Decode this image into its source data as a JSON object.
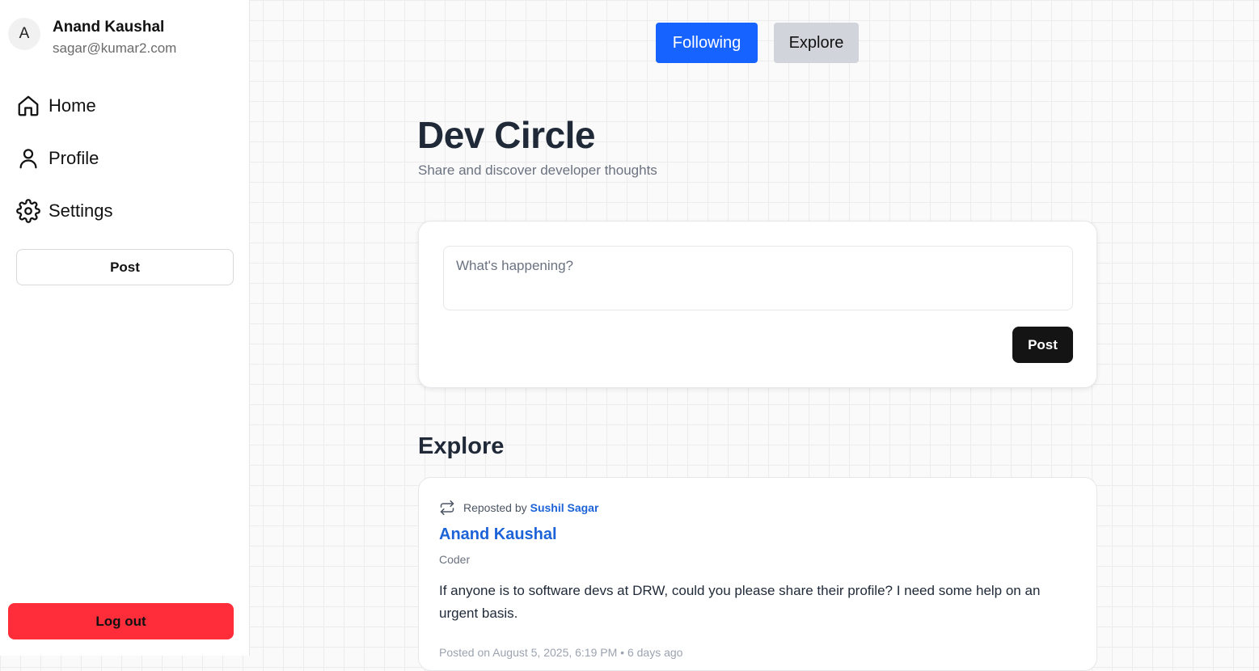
{
  "sidebar": {
    "user": {
      "avatar_initial": "A",
      "name": "Anand Kaushal",
      "email": "sagar@kumar2.com"
    },
    "nav": [
      {
        "label": "Home",
        "icon": "home-icon"
      },
      {
        "label": "Profile",
        "icon": "user-icon"
      },
      {
        "label": "Settings",
        "icon": "gear-icon"
      }
    ],
    "post_label": "Post",
    "logout_label": "Log out"
  },
  "tabs": {
    "following": "Following",
    "explore": "Explore",
    "active": "following"
  },
  "header": {
    "title": "Dev Circle",
    "subtitle": "Share and discover developer thoughts"
  },
  "composer": {
    "placeholder": "What's happening?",
    "post_label": "Post"
  },
  "feed": {
    "section_title": "Explore",
    "posts": [
      {
        "repost_prefix": "Reposted by",
        "reposted_by": "Sushil Sagar",
        "author": "Anand Kaushal",
        "role": "Coder",
        "body": "If anyone is to software devs at DRW, could you please share their profile? I need some help on an urgent basis.",
        "meta": "Posted on August 5, 2025, 6:19 PM • 6 days ago"
      }
    ]
  },
  "colors": {
    "accent": "#1763ff",
    "link": "#1d63d8",
    "danger": "#ff2d3a",
    "dark_button": "#141414",
    "inactive_tab": "#d1d5db"
  }
}
